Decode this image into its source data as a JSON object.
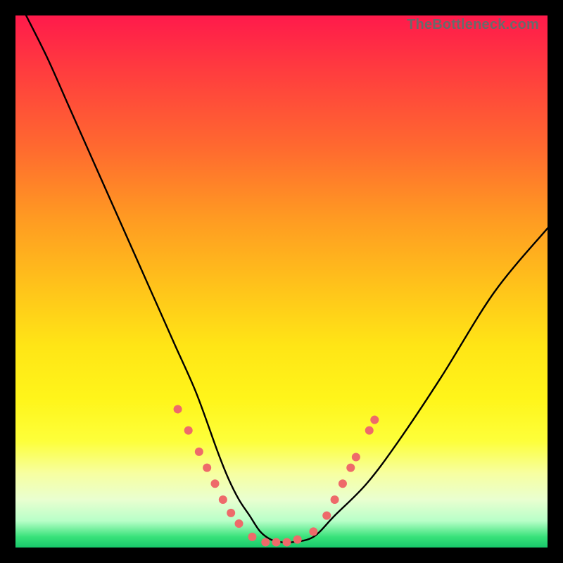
{
  "watermark": "TheBottleneck.com",
  "colors": {
    "curve": "#000000",
    "dots": "#ee6a6a",
    "background_frame": "#000000"
  },
  "chart_data": {
    "type": "line",
    "title": "",
    "xlabel": "",
    "ylabel": "",
    "xlim": [
      0,
      100
    ],
    "ylim": [
      0,
      100
    ],
    "grid": false,
    "legend": false,
    "series": [
      {
        "name": "bottleneck-curve",
        "x": [
          2,
          6,
          10,
          14,
          18,
          22,
          26,
          30,
          34,
          38,
          40,
          42,
          44,
          46,
          48,
          50,
          52,
          56,
          60,
          66,
          72,
          80,
          90,
          100
        ],
        "y": [
          100,
          92,
          83,
          74,
          65,
          56,
          47,
          38,
          29,
          18,
          13,
          9,
          6,
          3,
          1.5,
          1,
          1,
          2,
          6,
          12,
          20,
          32,
          48,
          60
        ]
      }
    ],
    "dot_markers": {
      "name": "highlighted-points",
      "points": [
        {
          "x": 30.5,
          "y": 26
        },
        {
          "x": 32.5,
          "y": 22
        },
        {
          "x": 34.5,
          "y": 18
        },
        {
          "x": 36.0,
          "y": 15
        },
        {
          "x": 37.5,
          "y": 12
        },
        {
          "x": 39.0,
          "y": 9
        },
        {
          "x": 40.5,
          "y": 6.5
        },
        {
          "x": 42.0,
          "y": 4.5
        },
        {
          "x": 44.5,
          "y": 2
        },
        {
          "x": 47.0,
          "y": 1
        },
        {
          "x": 49.0,
          "y": 1
        },
        {
          "x": 51.0,
          "y": 1
        },
        {
          "x": 53.0,
          "y": 1.5
        },
        {
          "x": 56.0,
          "y": 3
        },
        {
          "x": 58.5,
          "y": 6
        },
        {
          "x": 60.0,
          "y": 9
        },
        {
          "x": 61.5,
          "y": 12
        },
        {
          "x": 63.0,
          "y": 15
        },
        {
          "x": 64.0,
          "y": 17
        },
        {
          "x": 66.5,
          "y": 22
        },
        {
          "x": 67.5,
          "y": 24
        }
      ]
    }
  }
}
